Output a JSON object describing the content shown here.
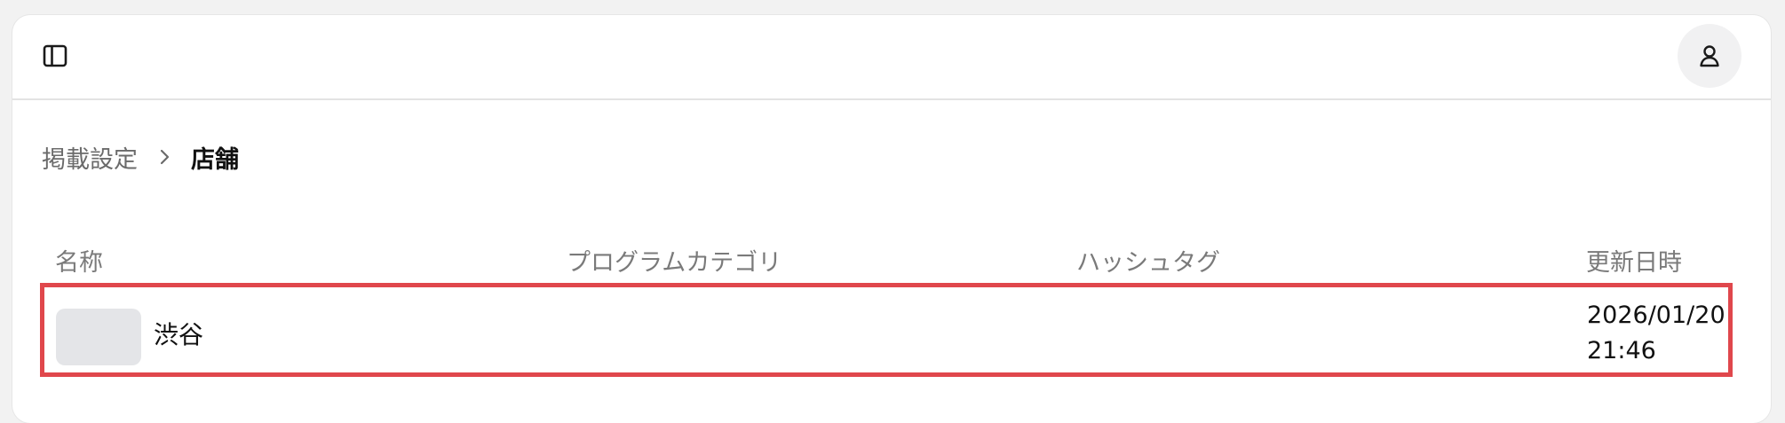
{
  "header": {
    "sidebar_toggle_icon": "sidebar-icon",
    "account_icon": "user-icon"
  },
  "breadcrumb": {
    "parent": "掲載設定",
    "separator_icon": "chevron-right-icon",
    "current": "店舗"
  },
  "table": {
    "columns": [
      "名称",
      "プログラムカテゴリ",
      "ハッシュタグ",
      "更新日時"
    ],
    "rows": [
      {
        "name": "渋谷",
        "program_category": "",
        "hashtags": "",
        "updated_date": "2026/01/20",
        "updated_time": "21:46"
      }
    ]
  },
  "colors": {
    "highlight_border": "#e0474c",
    "thumbnail_placeholder": "#e4e5e8",
    "muted_text": "#7a7a7a"
  }
}
